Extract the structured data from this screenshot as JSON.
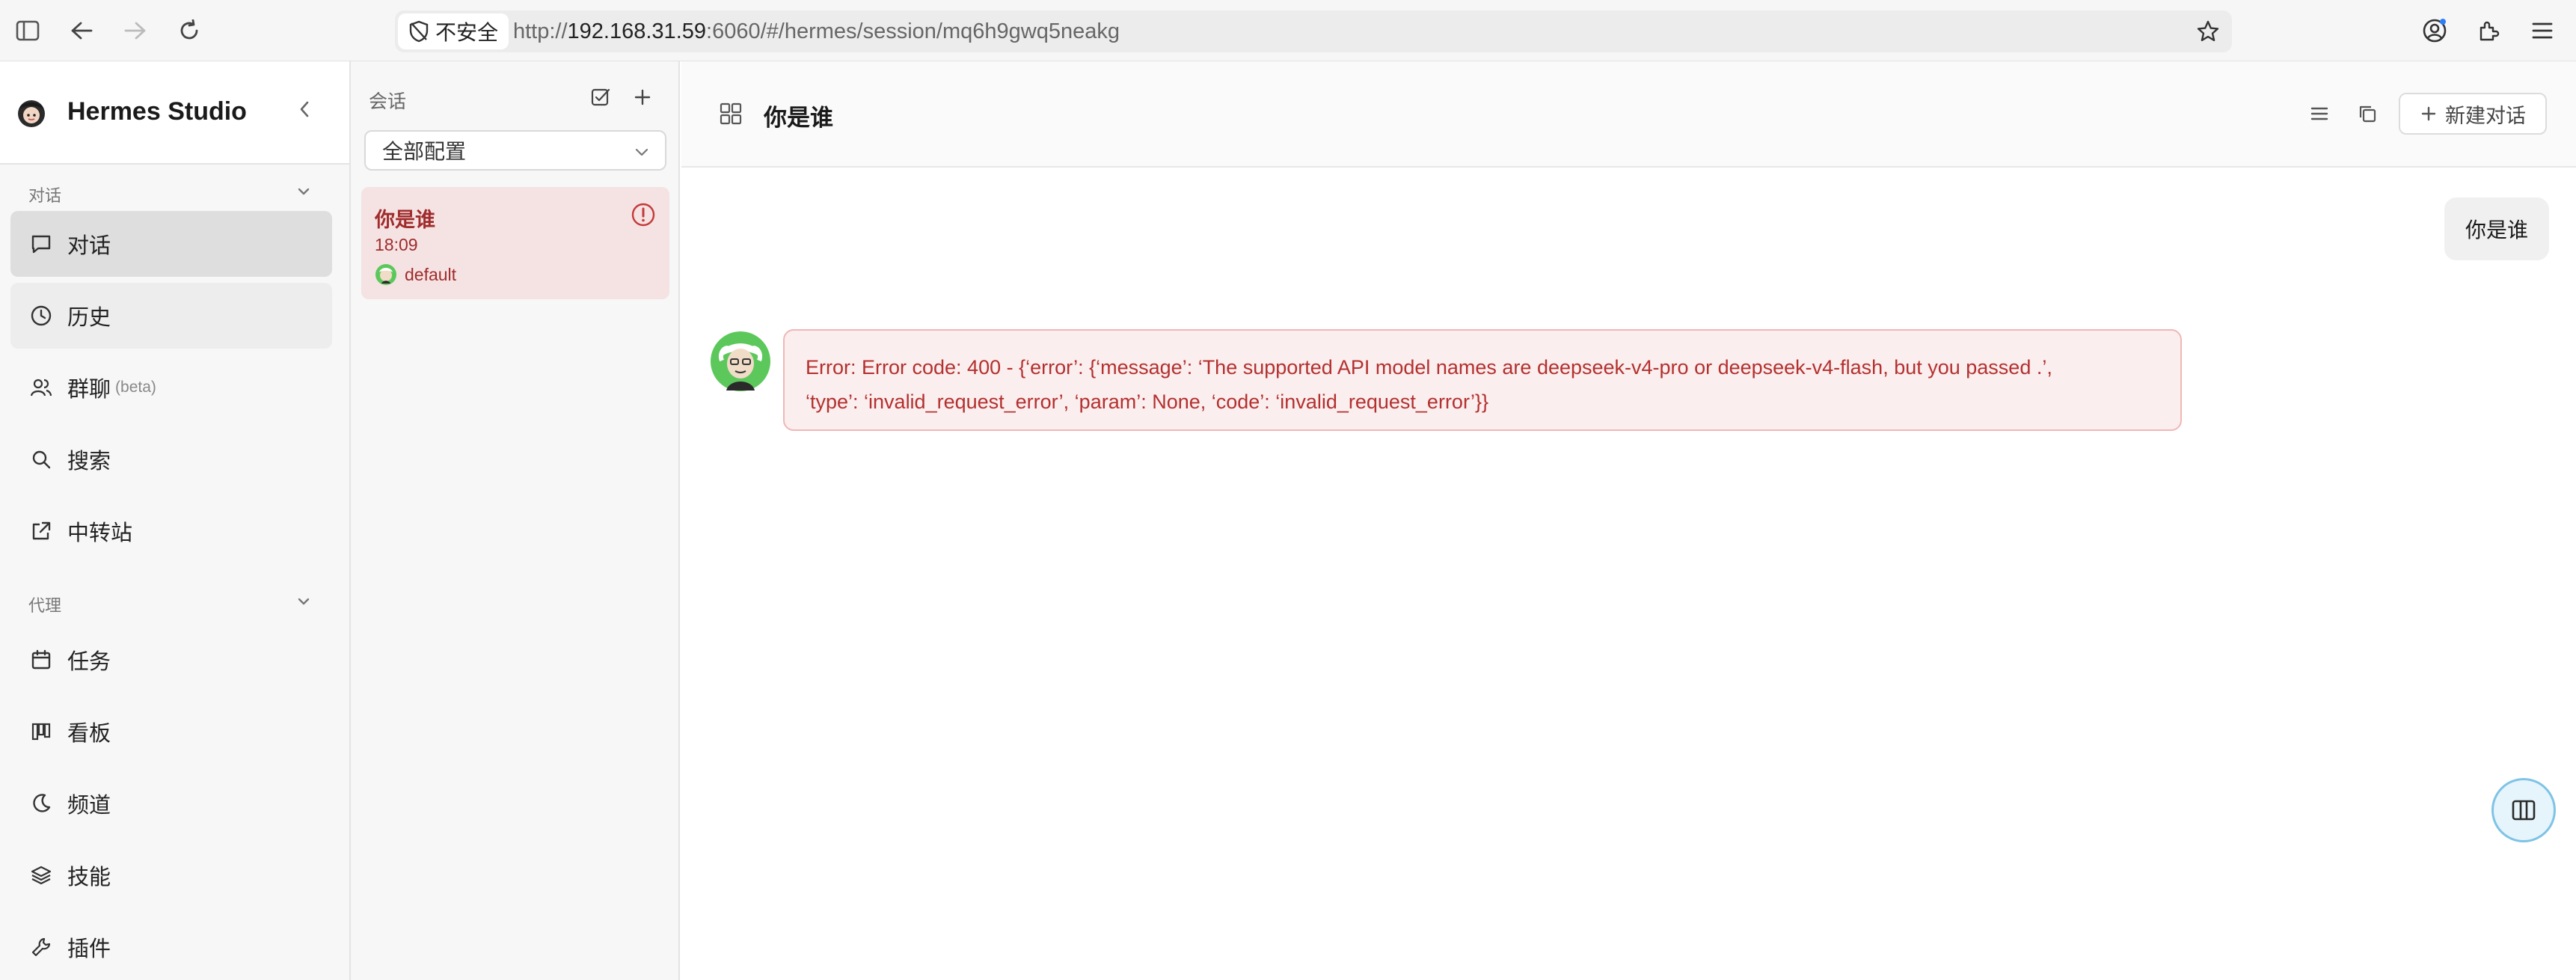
{
  "browser": {
    "insecure_label": "不安全",
    "url_prefix": "http://",
    "url_host": "192.168.31.59",
    "url_rest": ":6060/#/hermes/session/mq6h9gwq5neakg"
  },
  "sidebar": {
    "brand": "Hermes Studio",
    "sections": [
      {
        "label": "对话",
        "items": [
          {
            "label": "对话",
            "icon": "chat-bubble-icon",
            "active": true
          },
          {
            "label": "历史",
            "icon": "clock-icon"
          },
          {
            "label": "群聊",
            "sub": "(beta)",
            "icon": "users-icon"
          },
          {
            "label": "搜索",
            "icon": "search-icon"
          },
          {
            "label": "中转站",
            "icon": "external-link-icon"
          }
        ]
      },
      {
        "label": "代理",
        "items": [
          {
            "label": "任务",
            "icon": "calendar-icon"
          },
          {
            "label": "看板",
            "icon": "kanban-icon"
          },
          {
            "label": "频道",
            "icon": "moon-icon"
          },
          {
            "label": "技能",
            "icon": "layers-icon"
          },
          {
            "label": "插件",
            "icon": "wrench-icon"
          }
        ]
      }
    ]
  },
  "sessions": {
    "header": "会话",
    "filter": "全部配置",
    "items": [
      {
        "title": "你是谁",
        "time": "18:09",
        "agent": "default",
        "status": "error"
      }
    ]
  },
  "main": {
    "title": "你是谁",
    "new_chat_label": "新建对话",
    "user_message": "你是谁",
    "error_lines": [
      "Error: Error code: 400 - {‘error’: {‘message’: ‘The supported API model names are deepseek-v4-pro or deepseek-v4-flash, but you passed .’,",
      "‘type’: ‘invalid_request_error’, ‘param’: None, ‘code’: ‘invalid_request_error’}}"
    ]
  },
  "colors": {
    "accent_error": "#b3302f",
    "error_bg": "#fbeeee",
    "active_nav": "#dedede",
    "float_button": "#7fc3e6"
  }
}
